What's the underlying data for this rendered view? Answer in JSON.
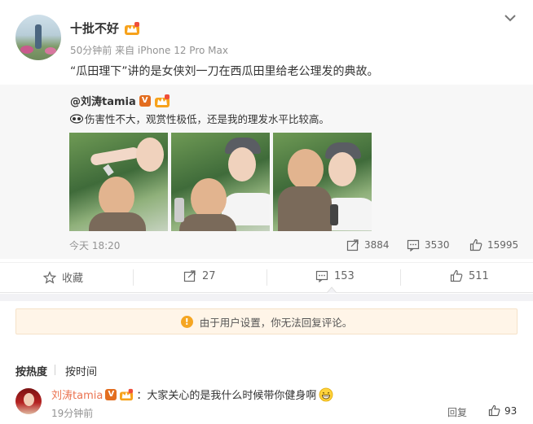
{
  "post": {
    "username": "十批不好",
    "meta": "50分钟前 来自 iPhone 12 Pro Max",
    "text": "“瓜田理下”讲的是女侠刘一刀在西瓜田里给老公理发的典故。"
  },
  "repost": {
    "user": "@刘涛tamia",
    "text": "伤害性不大，观赏性极低，还是我的理发水平比较高。",
    "time": "今天 18:20",
    "stats": {
      "share": "3884",
      "comment": "3530",
      "like": "15995"
    }
  },
  "actions": {
    "favorite": "收藏",
    "share": "27",
    "comment": "153",
    "like": "511"
  },
  "notice": "由于用户设置，你无法回复评论。",
  "sort": {
    "by_hot": "按热度",
    "by_time": "按时间"
  },
  "comment": {
    "user": "刘涛tamia",
    "vip_badge": "V",
    "text": "：大家关心的是我什么时候带你健身啊",
    "time": "19分钟前",
    "reply": "回复",
    "likes": "93"
  },
  "colors": {
    "name_orange": "#eb7350",
    "notice_bg": "#fff5e8",
    "notice_icon": "#f5a623"
  }
}
